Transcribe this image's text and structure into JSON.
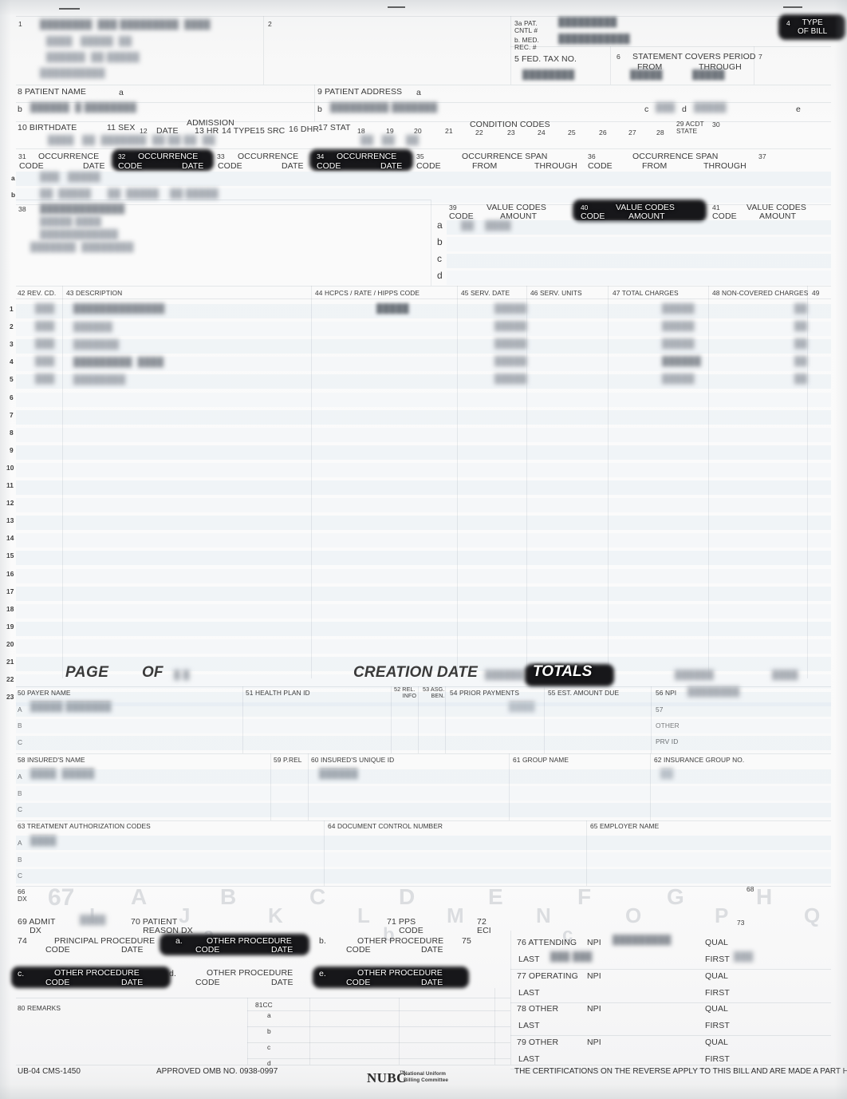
{
  "form": {
    "name": "UB-04 CMS-1450",
    "omb": "APPROVED OMB NO. 0938-0997",
    "certification": "THE CERTIFICATIONS ON THE REVERSE APPLY TO THIS BILL AND ARE MADE A PART HEREOF.",
    "logo_mark": "NUBC",
    "logo_tm": "™",
    "logo_line1": "National Uniform",
    "logo_line2": "Billing Committee"
  },
  "header": {
    "f1_num": "1",
    "f2_num": "2",
    "f3a_label": "3a PAT.\nCNTL #",
    "f3b_label": "b. MED.\nREC. #",
    "f4_num": "4",
    "f4_label": "TYPE\nOF BILL",
    "f5_label": "5 FED. TAX NO.",
    "f6_num": "6",
    "f6_label": "STATEMENT COVERS PERIOD",
    "f6_from": "FROM",
    "f6_through": "THROUGH",
    "f7_num": "7",
    "provider_blur_lines": [
      "████████  ███ █████████  ████",
      "████   █████  ██",
      "██████  ██ █████",
      "██████████"
    ]
  },
  "patient": {
    "f8_label": "8 PATIENT NAME",
    "f8_a": "a",
    "f8_b": "b",
    "f8_value": "██████  █ ████████",
    "f9_label": "9 PATIENT ADDRESS",
    "f9_a": "a",
    "f9_b": "b",
    "f9_value": "█████████ ███████",
    "f9_c": "c",
    "f9_d": "d",
    "f9_e": "e",
    "f10_label": "10 BIRTHDATE",
    "f11_label": "11 SEX",
    "f12_num": "12",
    "f12_label": "DATE",
    "admission_label": "ADMISSION",
    "f13_label": "13 HR",
    "f14_label": "14 TYPE",
    "f15_label": "15 SRC",
    "f16_label": "16 DHR",
    "f17_label": "17 STAT"
  },
  "condition_codes": {
    "title": "CONDITION CODES",
    "numbers": [
      "18",
      "19",
      "20",
      "21",
      "22",
      "23",
      "24",
      "25",
      "26",
      "27",
      "28"
    ],
    "f29_label": "29 ACDT\nSTATE",
    "f30_num": "30"
  },
  "occurrence": {
    "rows": [
      "a",
      "b"
    ],
    "fields": [
      {
        "num": "31",
        "title": "OCCURRENCE",
        "code": "CODE",
        "date": "DATE",
        "redacted": false
      },
      {
        "num": "32",
        "title": "OCCURRENCE",
        "code": "CODE",
        "date": "DATE",
        "redacted": true
      },
      {
        "num": "33",
        "title": "OCCURRENCE",
        "code": "CODE",
        "date": "DATE",
        "redacted": false
      },
      {
        "num": "34",
        "title": "OCCURRENCE",
        "code": "CODE",
        "date": "DATE",
        "redacted": true
      }
    ],
    "span_fields": [
      {
        "num": "35",
        "code": "CODE",
        "title": "OCCURRENCE SPAN",
        "from": "FROM",
        "through": "THROUGH"
      },
      {
        "num": "36",
        "code": "CODE",
        "title": "OCCURRENCE SPAN",
        "from": "FROM",
        "through": "THROUGH"
      }
    ],
    "f37_num": "37"
  },
  "f38": {
    "num": "38",
    "blur_lines": [
      "█████████████",
      "█████ ████",
      "████████████",
      "███████  ████████"
    ]
  },
  "value_codes": {
    "rows": [
      "a",
      "b",
      "c",
      "d"
    ],
    "fields": [
      {
        "num": "39",
        "code": "CODE",
        "title": "VALUE CODES",
        "amount": "AMOUNT",
        "redacted": false
      },
      {
        "num": "40",
        "code": "CODE",
        "title": "VALUE CODES",
        "amount": "AMOUNT",
        "redacted": true
      },
      {
        "num": "41",
        "code": "CODE",
        "title": "VALUE CODES",
        "amount": "AMOUNT",
        "redacted": false
      }
    ]
  },
  "service_lines": {
    "headers": {
      "f42": "42 REV. CD.",
      "f43": "43 DESCRIPTION",
      "f44": "44 HCPCS / RATE / HIPPS CODE",
      "f45": "45 SERV. DATE",
      "f46": "46 SERV. UNITS",
      "f47": "47 TOTAL CHARGES",
      "f48": "48 NON-COVERED CHARGES",
      "f49": "49"
    },
    "line_numbers": [
      "1",
      "2",
      "3",
      "4",
      "5",
      "6",
      "7",
      "8",
      "9",
      "10",
      "11",
      "12",
      "13",
      "14",
      "15",
      "16",
      "17",
      "18",
      "19",
      "20",
      "21",
      "22",
      "23"
    ],
    "filled_count": 5
  },
  "totals_row": {
    "page_label": "PAGE",
    "of_label": "OF",
    "creation_date_label": "CREATION DATE",
    "totals_label": "TOTALS",
    "totals_redacted": true
  },
  "payer": {
    "f50": "50 PAYER NAME",
    "f51": "51 HEALTH PLAN ID",
    "f52": "52 REL.\n     INFO",
    "f53": "53 ASG.\n     BEN.",
    "f54": "54 PRIOR PAYMENTS",
    "f55": "55 EST. AMOUNT DUE",
    "f56": "56 NPI",
    "f57": "57",
    "f57_other": "OTHER",
    "f57_prvid": "PRV ID",
    "rows": [
      "A",
      "B",
      "C"
    ],
    "payer_value": "█████ ███████"
  },
  "insured": {
    "f58": "58 INSURED'S NAME",
    "f59": "59 P.REL",
    "f60": "60 INSURED'S UNIQUE ID",
    "f61": "61 GROUP NAME",
    "f62": "62 INSURANCE GROUP NO.",
    "rows": [
      "A",
      "B",
      "C"
    ],
    "name_value": "████  █████",
    "id_value": "██████"
  },
  "authorization": {
    "f63": "63 TREATMENT AUTHORIZATION CODES",
    "f64": "64 DOCUMENT CONTROL NUMBER",
    "f65": "65 EMPLOYER NAME",
    "rows": [
      "A",
      "B",
      "C"
    ],
    "auth_value": "████"
  },
  "diagnosis": {
    "f66_label": "66\nDX",
    "f68_num": "68",
    "f73_num": "73",
    "watermark_67": "67",
    "watermark_row1": [
      "A",
      "B",
      "C",
      "D",
      "E",
      "F",
      "G",
      "H"
    ],
    "watermark_row2": [
      "I",
      "J",
      "K",
      "L",
      "M",
      "N",
      "O",
      "P",
      "Q"
    ],
    "watermark_row3": [
      "a",
      "b",
      "c"
    ],
    "f69": "69 ADMIT\n     DX",
    "f70": "70 PATIENT\n     REASON DX",
    "f71": "71 PPS\n     CODE",
    "f72": "72\nECI",
    "f75_num": "75"
  },
  "procedures": {
    "f74_num": "74",
    "principal_title": "PRINCIPAL PROCEDURE",
    "code": "CODE",
    "date": "DATE",
    "others": [
      {
        "letter": "a.",
        "title": "OTHER PROCEDURE",
        "redacted": true
      },
      {
        "letter": "b.",
        "title": "OTHER PROCEDURE",
        "redacted": false
      },
      {
        "letter": "c.",
        "title": "OTHER PROCEDURE",
        "redacted": true
      },
      {
        "letter": "d.",
        "title": "OTHER PROCEDURE",
        "redacted": false
      },
      {
        "letter": "e.",
        "title": "OTHER PROCEDURE",
        "redacted": true
      }
    ]
  },
  "providers": {
    "qual": "QUAL",
    "npi": "NPI",
    "last": "LAST",
    "first": "FIRST",
    "entries": [
      {
        "num": "76",
        "role": "ATTENDING",
        "npi_value": "█████████",
        "last_value": "███ ███",
        "first_value": "███"
      },
      {
        "num": "77",
        "role": "OPERATING",
        "npi_value": "",
        "last_value": "",
        "first_value": ""
      },
      {
        "num": "78",
        "role": "OTHER",
        "npi_value": "",
        "last_value": "",
        "first_value": ""
      },
      {
        "num": "79",
        "role": "OTHER",
        "npi_value": "",
        "last_value": "",
        "first_value": ""
      }
    ]
  },
  "remarks": {
    "f80": "80 REMARKS",
    "f81": "81CC",
    "rows": [
      "a",
      "b",
      "c",
      "d"
    ]
  }
}
